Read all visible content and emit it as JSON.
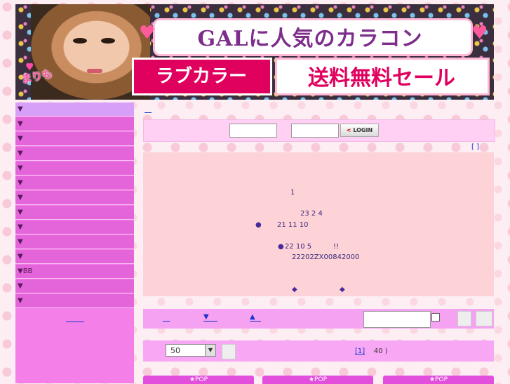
{
  "banner": {
    "title": "GALに人気のカラコン",
    "girl_name": "まりも",
    "label": "ラブカラー",
    "sale": "送料無料セール"
  },
  "sidebar": {
    "items": [
      "▼",
      "▼",
      "▼",
      "▼",
      "▼",
      "▼",
      "▼",
      "▼",
      "▼",
      "▼",
      "▼",
      "▼BB",
      "▼",
      "▼"
    ]
  },
  "login": {
    "button_label": "LOGIN",
    "button_arrow": "<"
  },
  "top_right_link": "[      ]",
  "content": {
    "line1": "1",
    "line2": "23 2 4",
    "line3_bullet": "●",
    "line3": "21 11 10",
    "line4_bullet": "●",
    "line4": "22 10 5",
    "line4_excl": "!!",
    "line5": "22202ZX00842000",
    "diamond1": "◆",
    "diamond2": "◆"
  },
  "filter": {
    "down_label": "▼",
    "up_label": "▲"
  },
  "pagination": {
    "per_page": "50",
    "page_link": "[1]",
    "count": "40 )"
  },
  "pop_tabs": [
    "★POP",
    "★POP",
    "★POP"
  ]
}
